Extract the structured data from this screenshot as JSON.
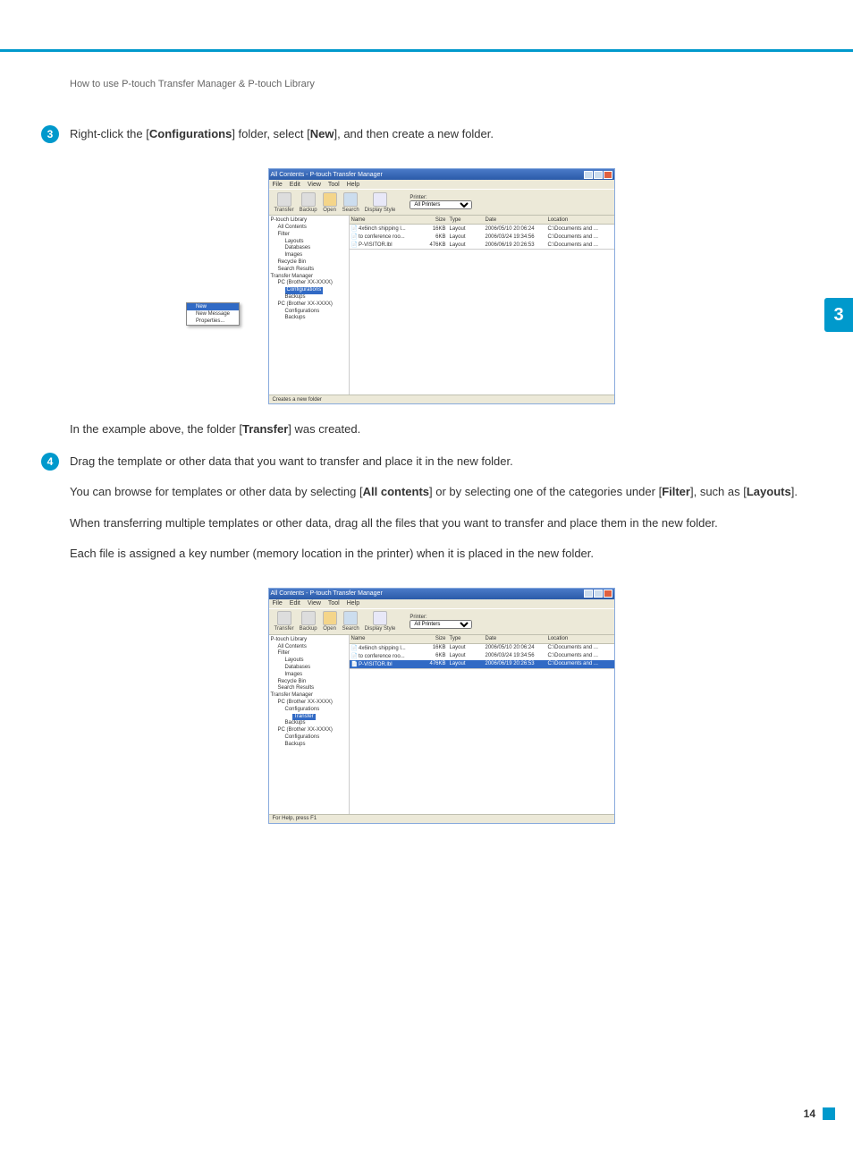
{
  "breadcrumb": "How to use P-touch Transfer Manager & P-touch Library",
  "side_tab": "3",
  "page_number": "14",
  "step3": {
    "num": "3",
    "text_parts": [
      "Right-click the [",
      "Configurations",
      "] folder, select [",
      "New",
      "], and then create a new folder."
    ],
    "caption": [
      "In the example above, the folder [",
      "Transfer",
      "] was created."
    ]
  },
  "step4": {
    "num": "4",
    "line1": "Drag the template or other data that you want to transfer and place it in the new folder.",
    "p2_parts": [
      "You can browse for templates or other data by selecting [",
      "All contents",
      "] or by selecting one of the categories under [",
      "Filter",
      "], such as [",
      "Layouts",
      "]."
    ],
    "p3": "When transferring multiple templates or other data, drag all the files that you want to transfer and place them in the new folder.",
    "p4": "Each file is assigned a key number (memory location in the printer) when it is placed in the new folder."
  },
  "win": {
    "title": "All Contents - P-touch Transfer Manager",
    "menu": [
      "File",
      "Edit",
      "View",
      "Tool",
      "Help"
    ],
    "toolbar": {
      "transfer": "Transfer",
      "backup": "Backup",
      "open": "Open",
      "search": "Search",
      "display": "Display Style",
      "printer_label": "Printer:",
      "printer_value": "All Printers"
    },
    "columns": {
      "name": "Name",
      "size": "Size",
      "type": "Type",
      "date": "Date",
      "location": "Location"
    },
    "rows": [
      {
        "name": "4x6inch shipping l...",
        "size": "16KB",
        "type": "Layout",
        "date": "2006/05/10 20:06:24",
        "loc": "C:\\Documents and ..."
      },
      {
        "name": "to conference roo...",
        "size": "6KB",
        "type": "Layout",
        "date": "2006/03/24 19:34:56",
        "loc": "C:\\Documents and ..."
      },
      {
        "name": "P-VISITOR.lbl",
        "size": "476KB",
        "type": "Layout",
        "date": "2006/06/19 20:26:53",
        "loc": "C:\\Documents and ..."
      }
    ],
    "tree1": [
      "P-touch Library",
      "All Contents",
      "Filter",
      "Layouts",
      "Databases",
      "Images",
      "Recycle Bin",
      "Search Results",
      "Transfer Manager",
      "PC (Brother XX-XXXX)",
      "Configurations",
      "Backups",
      "PC (Brother XX-XXXX)",
      "Configurations",
      "Backups"
    ],
    "tree2": [
      "P-touch Library",
      "All Contents",
      "Filter",
      "Layouts",
      "Databases",
      "Images",
      "Recycle Bin",
      "Search Results",
      "Transfer Manager",
      "PC (Brother XX-XXXX)",
      "Configurations",
      "Transfer",
      "Backups",
      "PC (Brother XX-XXXX)",
      "Configurations",
      "Backups"
    ],
    "context": [
      "New",
      "New Message",
      "Properties..."
    ],
    "status1": "Creates a new folder",
    "status2": "For Help, press F1"
  }
}
